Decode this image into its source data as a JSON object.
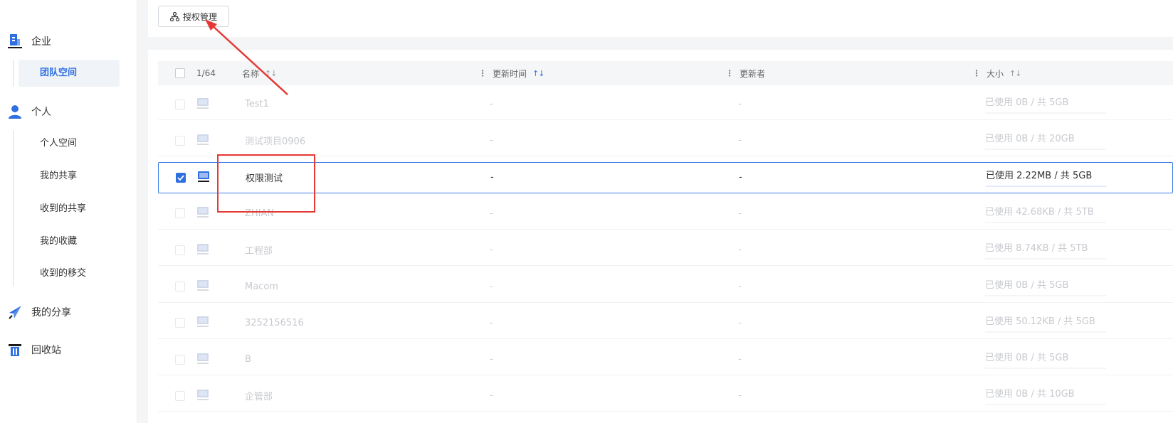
{
  "sidebar": {
    "enterprise": {
      "label": "企业",
      "icon": "enterprise-icon"
    },
    "team_space": {
      "label": "团队空间"
    },
    "personal": {
      "label": "个人",
      "icon": "user-icon"
    },
    "personal_items": [
      {
        "label": "个人空间"
      },
      {
        "label": "我的共享"
      },
      {
        "label": "收到的共享"
      },
      {
        "label": "我的收藏"
      },
      {
        "label": "收到的移交"
      }
    ],
    "my_shares": {
      "label": "我的分享",
      "icon": "paper-plane-icon"
    },
    "recycle": {
      "label": "回收站",
      "icon": "trash-icon"
    }
  },
  "toolbar": {
    "auth_label": "授权管理",
    "auth_icon": "org-chart-icon"
  },
  "table": {
    "selection_count": "1/64",
    "columns": {
      "name": "名称",
      "updated_time": "更新时间",
      "updater": "更新者",
      "size": "大小"
    },
    "sort_glyph": "↑↓",
    "rows": [
      {
        "name": "Test1",
        "time": "-",
        "updater": "-",
        "size": "已使用 0B / 共 5GB",
        "selected": false
      },
      {
        "name": "测试项目0906",
        "time": "-",
        "updater": "-",
        "size": "已使用 0B / 共 20GB",
        "selected": false
      },
      {
        "name": "权限测试",
        "time": "-",
        "updater": "-",
        "size": "已使用 2.22MB / 共 5GB",
        "selected": true
      },
      {
        "name": "ZHIAN",
        "time": "-",
        "updater": "-",
        "size": "已使用 42.68KB / 共 5TB",
        "selected": false
      },
      {
        "name": "工程部",
        "time": "-",
        "updater": "-",
        "size": "已使用 8.74KB / 共 5TB",
        "selected": false
      },
      {
        "name": "Macom",
        "time": "-",
        "updater": "-",
        "size": "已使用 0B / 共 5GB",
        "selected": false
      },
      {
        "name": "3252156516",
        "time": "-",
        "updater": "-",
        "size": "已使用 50.12KB / 共 5GB",
        "selected": false
      },
      {
        "name": "B",
        "time": "-",
        "updater": "-",
        "size": "已使用 0B / 共 5GB",
        "selected": false
      },
      {
        "name": "企管部",
        "time": "-",
        "updater": "-",
        "size": "已使用 0B / 共 10GB",
        "selected": false
      }
    ]
  },
  "colors": {
    "accent": "#2f6fe0",
    "annotation": "#e53935"
  }
}
